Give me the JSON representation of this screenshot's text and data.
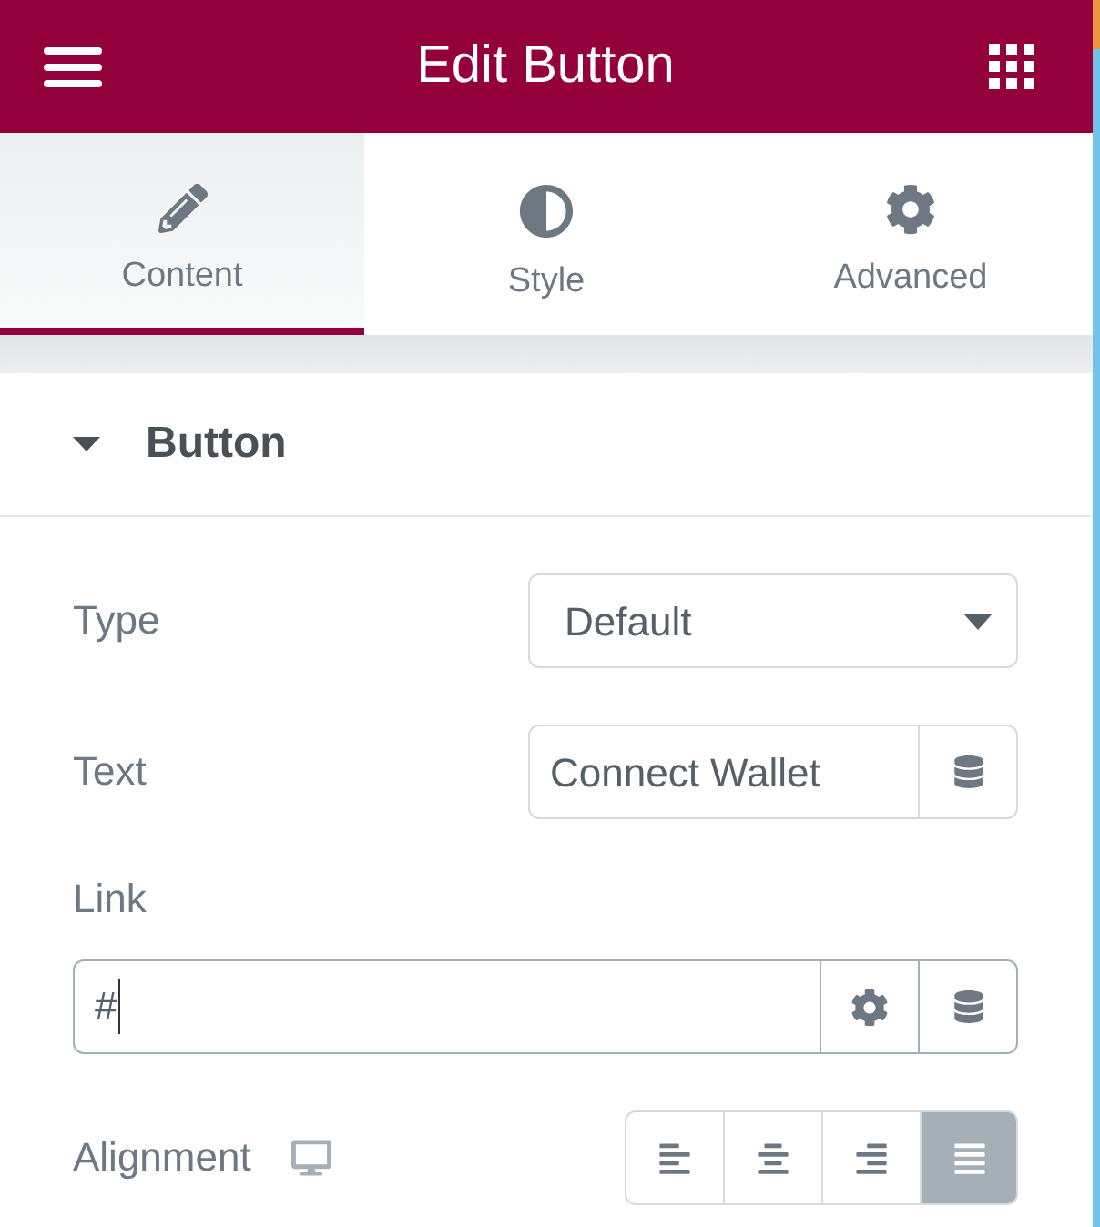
{
  "header": {
    "title": "Edit Button"
  },
  "tabs": [
    {
      "label": "Content",
      "selected": true
    },
    {
      "label": "Style",
      "selected": false
    },
    {
      "label": "Advanced",
      "selected": false
    }
  ],
  "section": {
    "title": "Button",
    "expanded": true
  },
  "controls": [
    {
      "kind": "select",
      "label": "Type",
      "value": "Default"
    },
    {
      "kind": "text",
      "label": "Text",
      "value": "Connect Wallet"
    },
    {
      "kind": "url",
      "label": "Link",
      "value": "#",
      "focused": true
    },
    {
      "kind": "choose",
      "label": "Alignment",
      "options": [
        {
          "selected": false
        },
        {
          "selected": false
        },
        {
          "selected": false
        },
        {
          "selected": true
        }
      ]
    }
  ]
}
